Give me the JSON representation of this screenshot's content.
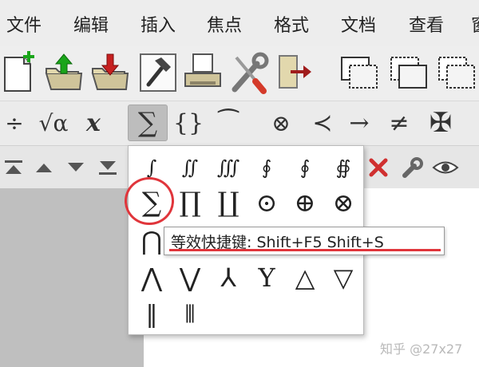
{
  "menubar": {
    "items": [
      {
        "label": "文件"
      },
      {
        "label": "编辑"
      },
      {
        "label": "插入"
      },
      {
        "label": "焦点"
      },
      {
        "label": "格式"
      },
      {
        "label": "文档"
      },
      {
        "label": "查看"
      },
      {
        "label": "窗"
      }
    ]
  },
  "toolbar": {
    "icons": [
      "new-document-icon",
      "open-upload-icon",
      "save-download-icon",
      "build-hammer-icon",
      "print-icon",
      "tools-wrench-screwdriver-icon",
      "export-arrow-icon",
      "frames-icon",
      "frames-copy-icon",
      "frames-dashed-icon"
    ]
  },
  "mathbar": {
    "items": [
      {
        "icon": "fraction-icon",
        "glyph": "÷"
      },
      {
        "icon": "square-root-icon",
        "glyph": "√α"
      },
      {
        "icon": "superscript-x-icon",
        "glyph": "x"
      },
      {
        "icon": "big-operator-sum-icon",
        "glyph": "∑",
        "active": true
      },
      {
        "icon": "braces-icon",
        "glyph": "{}"
      },
      {
        "icon": "tilde-accent-icon",
        "glyph": "⁀"
      },
      {
        "icon": "circled-times-icon",
        "glyph": "⊗"
      },
      {
        "icon": "precedes-icon",
        "glyph": "≺"
      },
      {
        "icon": "right-arrow-icon",
        "glyph": "→"
      },
      {
        "icon": "not-equal-icon",
        "glyph": "≠"
      },
      {
        "icon": "maltese-cross-icon",
        "glyph": "✠"
      }
    ]
  },
  "lowerbar": {
    "icons": [
      "move-top-icon",
      "move-up-icon",
      "move-down-icon",
      "move-bottom-icon",
      "delete-x-icon",
      "wrench-icon",
      "eye-icon"
    ]
  },
  "palette": {
    "row1": [
      "∫",
      "∬",
      "∭",
      "∮",
      "∮",
      "∯"
    ],
    "row2": [
      "∑",
      "∏",
      "∐",
      "⊙",
      "⊕",
      "⊗"
    ],
    "row3": [
      "⋂"
    ],
    "row4": [
      "⋀",
      "⋁",
      "⅄",
      "Y",
      "△",
      "▽"
    ],
    "row5": [
      "‖",
      "⦀"
    ]
  },
  "tooltip": {
    "text": "等效快捷键: Shift+F5  Shift+S"
  },
  "watermark": {
    "text": "知乎 @27x27"
  },
  "colors": {
    "highlight": "#e0353b",
    "active_button": "#bdbdbd"
  }
}
